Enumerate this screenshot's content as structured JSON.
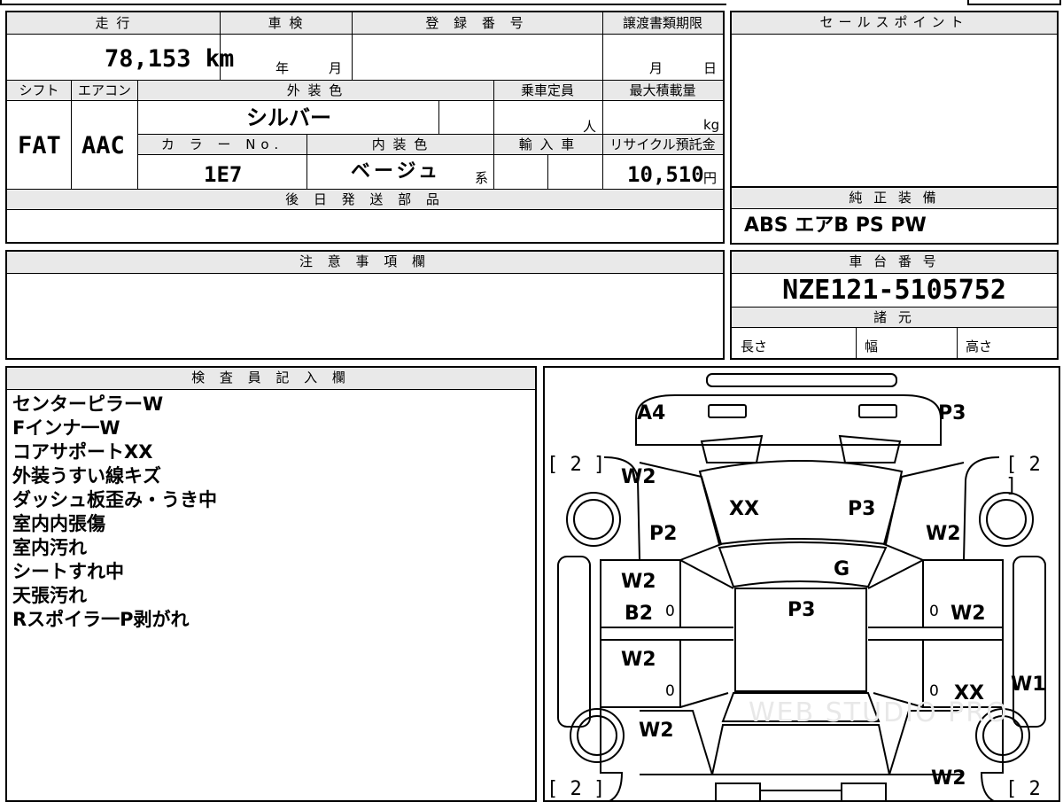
{
  "vehicle": {
    "mileage_label": "走 行",
    "mileage_value": "78,153 km",
    "inspection_label": "車 検",
    "inspection_year": "年",
    "inspection_month": "月",
    "registration_label": "登 録 番 号",
    "transfer_label": "譲渡書類期限",
    "transfer_month": "月",
    "transfer_day": "日",
    "shift_label": "シフト",
    "shift_value": "FAT",
    "aircon_label": "エアコン",
    "aircon_value": "AAC",
    "exterior_color_label": "外 装 色",
    "exterior_color_value": "シルバー",
    "capacity_label": "乗車定員",
    "capacity_unit": "人",
    "max_load_label": "最大積載量",
    "max_load_unit": "kg",
    "color_no_label": "カ ラ ー No.",
    "color_no_value": "1E7",
    "interior_color_label": "内 装 色",
    "interior_color_value": "ベージュ",
    "interior_color_suffix": "系",
    "import_label": "輸 入 車",
    "recycle_label": "リサイクル預託金",
    "recycle_value": "10,510",
    "recycle_unit": "円"
  },
  "sales_point": {
    "label": "セールスポイント"
  },
  "later_parts": {
    "label": "後 日 発 送 部 品"
  },
  "standard_equipment": {
    "label": "純 正 装 備",
    "value": "ABS エアB PS PW"
  },
  "caution": {
    "label": "注 意 事 項 欄"
  },
  "chassis": {
    "label": "車 台 番 号",
    "value": "NZE121-5105752"
  },
  "specs": {
    "label": "諸 元",
    "length": "長さ",
    "width": "幅",
    "height": "高さ"
  },
  "inspector": {
    "label": "検 査 員 記 入 欄",
    "notes": [
      "センターピラーW",
      "Fインナ一W",
      "コアサポートXX",
      "外装うすい線キズ",
      "ダッシュ板歪み・うき中",
      "室内内張傷",
      "室内汚れ",
      "シートすれ中",
      "天張汚れ",
      "Rスポイラ一P剥がれ"
    ]
  },
  "diagram": {
    "marks": {
      "a4": "A4",
      "p3_front_right": "P3",
      "w2_front_left": "W2",
      "xx_hood": "XX",
      "p3_hood": "P3",
      "p2": "P2",
      "w2_front_right": "W2",
      "g": "G",
      "w2_fl_door": "W2",
      "b2": "B2",
      "p3_roof": "P3",
      "w2_fr_door": "W2",
      "w2_rl_door": "W2",
      "xx_rr_door": "XX",
      "w1": "W1",
      "w2_rear_left": "W2",
      "w2_rear_right": "W2"
    },
    "tire_fl": "[ 2 ]",
    "tire_fr": "[ 2 ]",
    "tire_rl": "[ 2 ]",
    "tire_rr": "[ 2 ]",
    "zero_mark": "0",
    "watermark": "WEB STUDIO PRO"
  }
}
